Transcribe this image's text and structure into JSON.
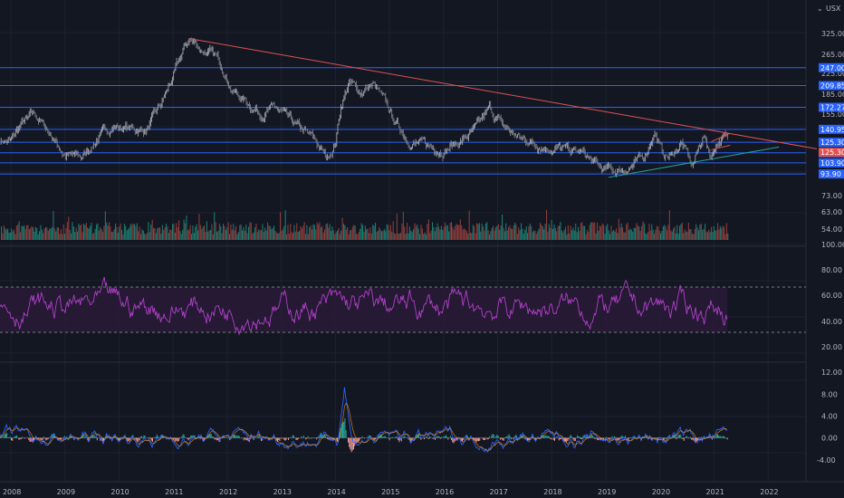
{
  "header": {
    "currency_label": "USX"
  },
  "colors": {
    "background": "#131722",
    "grid": "#1e222d",
    "hline": "#2962ff",
    "trendline_down": "#e05252",
    "trendline_up": "#26a69a",
    "candle_up": "#b2b5be",
    "candle_down": "#8a8d96",
    "volume_up": "#1c7a6f",
    "volume_down": "#8b3b3b",
    "rsi": "#b040c8",
    "rsi_band": "#2a1a3a",
    "macd": "#2962ff",
    "signal": "#ff9800",
    "hist_up": "#26a69a",
    "hist_down": "#ef9a9a",
    "tag_blue": "#2962ff",
    "tag_red": "#e05252"
  },
  "chart_data": [
    {
      "type": "line",
      "panel": "price",
      "scale": "log",
      "ylim": [
        88,
        340
      ],
      "y_ticks": [
        "325.00",
        "265.00",
        "225.00",
        "185.00",
        "155.00",
        "73.00",
        "63.00",
        "54.00"
      ],
      "x_ticks": [
        "2008",
        "2009",
        "2010",
        "2011",
        "2012",
        "2013",
        "2014",
        "2015",
        "2016",
        "2017",
        "2018",
        "2019",
        "2020",
        "2021",
        "2022"
      ],
      "x_range": [
        2007.8,
        2022.7
      ],
      "horizontal_levels": [
        {
          "value": 247.0,
          "label": "247.00"
        },
        {
          "value": 209.85,
          "label": "209.85"
        },
        {
          "value": 172.27,
          "label": "172.27"
        },
        {
          "value": 140.95,
          "label": "140.95"
        },
        {
          "value": 125.3,
          "label": "125.30"
        },
        {
          "value": 113.9,
          "label": "113.90"
        },
        {
          "value": 103.9,
          "label": "103.90"
        },
        {
          "value": 93.9,
          "label": "93.90"
        }
      ],
      "last_price": {
        "value": 125.3,
        "label": "125.30"
      },
      "price_points": [
        [
          2007.8,
          128
        ],
        [
          2008.0,
          126
        ],
        [
          2008.2,
          148
        ],
        [
          2008.45,
          160
        ],
        [
          2008.7,
          138
        ],
        [
          2009.0,
          112
        ],
        [
          2009.3,
          108
        ],
        [
          2009.6,
          130
        ],
        [
          2009.9,
          146
        ],
        [
          2010.2,
          142
        ],
        [
          2010.5,
          140
        ],
        [
          2010.75,
          170
        ],
        [
          2011.0,
          225
        ],
        [
          2011.2,
          290
        ],
        [
          2011.3,
          320
        ],
        [
          2011.5,
          295
        ],
        [
          2011.7,
          280
        ],
        [
          2011.9,
          255
        ],
        [
          2012.1,
          200
        ],
        [
          2012.3,
          185
        ],
        [
          2012.6,
          165
        ],
        [
          2012.9,
          170
        ],
        [
          2013.2,
          148
        ],
        [
          2013.6,
          128
        ],
        [
          2013.85,
          108
        ],
        [
          2014.0,
          125
        ],
        [
          2014.1,
          175
        ],
        [
          2014.25,
          215
        ],
        [
          2014.45,
          198
        ],
        [
          2014.7,
          212
        ],
        [
          2014.9,
          180
        ],
        [
          2015.1,
          150
        ],
        [
          2015.4,
          126
        ],
        [
          2015.7,
          120
        ],
        [
          2016.0,
          118
        ],
        [
          2016.3,
          126
        ],
        [
          2016.6,
          140
        ],
        [
          2016.85,
          168
        ],
        [
          2017.1,
          145
        ],
        [
          2017.4,
          130
        ],
        [
          2017.7,
          124
        ],
        [
          2018.0,
          120
        ],
        [
          2018.3,
          116
        ],
        [
          2018.6,
          112
        ],
        [
          2018.9,
          98
        ],
        [
          2019.2,
          96
        ],
        [
          2019.5,
          102
        ],
        [
          2019.7,
          108
        ],
        [
          2019.9,
          140
        ],
        [
          2020.05,
          112
        ],
        [
          2020.2,
          110
        ],
        [
          2020.4,
          125
        ],
        [
          2020.6,
          100
        ],
        [
          2020.8,
          134
        ],
        [
          2020.95,
          110
        ],
        [
          2021.05,
          126
        ],
        [
          2021.2,
          132
        ],
        [
          2021.25,
          125.3
        ]
      ],
      "trendline_down": [
        [
          2011.3,
          322
        ],
        [
          2022.9,
          118
        ]
      ],
      "trendline_up": [
        [
          2019.05,
          91
        ],
        [
          2022.2,
          120
        ]
      ],
      "pennant_upper": [
        [
          2020.95,
          126
        ],
        [
          2021.3,
          136
        ]
      ],
      "pennant_lower": [
        [
          2020.95,
          117
        ],
        [
          2021.3,
          122
        ]
      ]
    },
    {
      "type": "bar",
      "panel": "volume",
      "x_range": [
        2007.8,
        2021.25
      ]
    },
    {
      "type": "line",
      "panel": "rsi",
      "ylim": [
        10,
        90
      ],
      "y_ticks": [
        "100.00",
        "80.00",
        "60.00",
        "40.00",
        "20.00"
      ],
      "band": [
        30,
        70
      ],
      "x_range": [
        2007.8,
        2021.25
      ]
    },
    {
      "type": "line",
      "panel": "macd",
      "ylim": [
        -6,
        13
      ],
      "y_ticks": [
        "12.00",
        "8.00",
        "4.00",
        "0.00",
        "-4.00"
      ],
      "x_range": [
        2007.8,
        2021.25
      ],
      "spike": {
        "x": 2014.17,
        "value": 10.5
      }
    }
  ]
}
